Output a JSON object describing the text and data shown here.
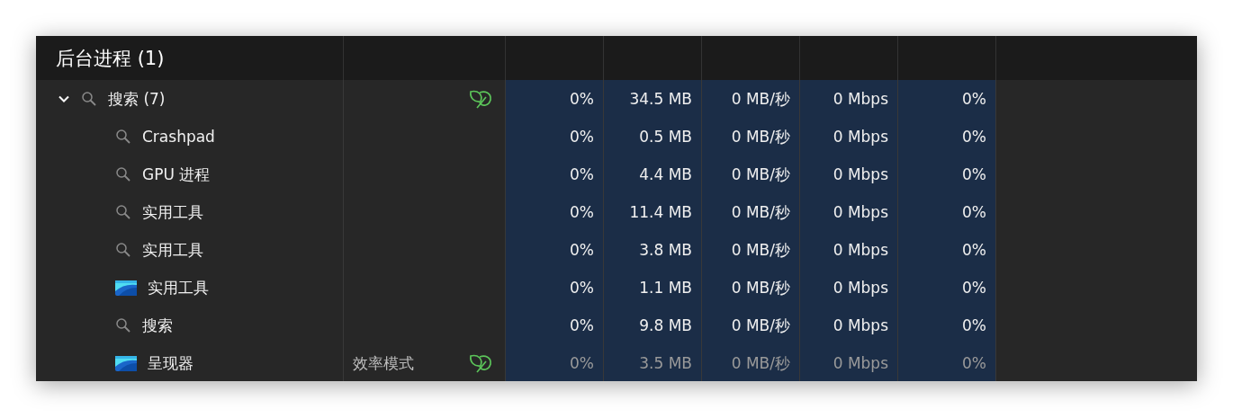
{
  "section": {
    "title": "后台进程 (1)"
  },
  "group": {
    "name": "搜索 (7)",
    "kind": "search",
    "expanded": true,
    "leaf": true,
    "dimmed": false,
    "cpu": "0%",
    "memory": "34.5 MB",
    "disk": "0 MB/秒",
    "network": "0 Mbps",
    "gpu": "0%",
    "children": [
      {
        "name": "Crashpad",
        "kind": "search",
        "leaf": false,
        "dimmed": false,
        "cpu": "0%",
        "memory": "0.5 MB",
        "disk": "0 MB/秒",
        "network": "0 Mbps",
        "gpu": "0%"
      },
      {
        "name": "GPU 进程",
        "kind": "search",
        "leaf": false,
        "dimmed": false,
        "cpu": "0%",
        "memory": "4.4 MB",
        "disk": "0 MB/秒",
        "network": "0 Mbps",
        "gpu": "0%"
      },
      {
        "name": "实用工具",
        "kind": "search",
        "leaf": false,
        "dimmed": false,
        "cpu": "0%",
        "memory": "11.4 MB",
        "disk": "0 MB/秒",
        "network": "0 Mbps",
        "gpu": "0%"
      },
      {
        "name": "实用工具",
        "kind": "search",
        "leaf": false,
        "dimmed": false,
        "cpu": "0%",
        "memory": "3.8 MB",
        "disk": "0 MB/秒",
        "network": "0 Mbps",
        "gpu": "0%"
      },
      {
        "name": "实用工具",
        "kind": "app",
        "leaf": false,
        "dimmed": false,
        "cpu": "0%",
        "memory": "1.1 MB",
        "disk": "0 MB/秒",
        "network": "0 Mbps",
        "gpu": "0%"
      },
      {
        "name": "搜索",
        "kind": "search",
        "leaf": false,
        "dimmed": false,
        "cpu": "0%",
        "memory": "9.8 MB",
        "disk": "0 MB/秒",
        "network": "0 Mbps",
        "gpu": "0%"
      },
      {
        "name": "呈现器",
        "kind": "app",
        "status": "效率模式",
        "leaf": true,
        "dimmed": true,
        "cpu": "0%",
        "memory": "3.5 MB",
        "disk": "0 MB/秒",
        "network": "0 Mbps",
        "gpu": "0%"
      }
    ]
  }
}
